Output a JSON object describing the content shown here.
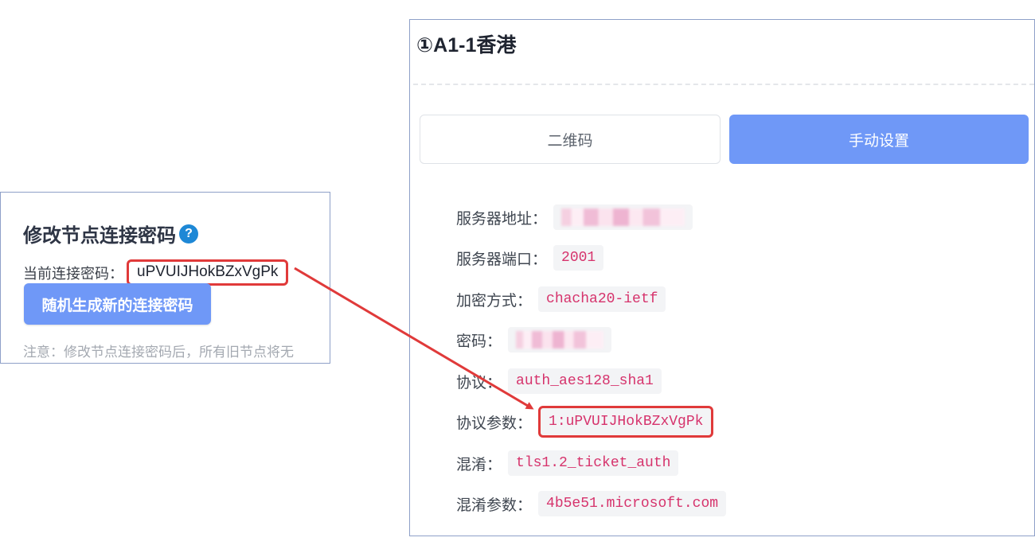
{
  "left_panel": {
    "title": "修改节点连接密码",
    "help_icon_glyph": "?",
    "current_label": "当前连接密码：",
    "current_password": "uPVUIJHokBZxVgPk",
    "generate_button": "随机生成新的连接密码",
    "note": "注意：修改节点连接密码后，所有旧节点将无"
  },
  "right_panel": {
    "title": "①A1-1香港",
    "tabs": [
      {
        "label": "二维码",
        "active": false
      },
      {
        "label": "手动设置",
        "active": true
      }
    ],
    "rows": [
      {
        "label": "服务器地址：",
        "value": "",
        "masked": true
      },
      {
        "label": "服务器端口：",
        "value": "2001"
      },
      {
        "label": "加密方式：",
        "value": "chacha20-ietf"
      },
      {
        "label": "密码：",
        "value": "",
        "masked": true
      },
      {
        "label": "协议：",
        "value": "auth_aes128_sha1"
      },
      {
        "label": "协议参数：",
        "value": "1:uPVUIJHokBZxVgPk",
        "highlight": true
      },
      {
        "label": "混淆：",
        "value": "tls1.2_ticket_auth"
      },
      {
        "label": "混淆参数：",
        "value": "4b5e51.microsoft.com"
      }
    ]
  },
  "colors": {
    "accent": "#6f98f7",
    "highlight_border": "#e03a3a",
    "code_text": "#d6336c",
    "help_icon": "#1e88d6"
  }
}
